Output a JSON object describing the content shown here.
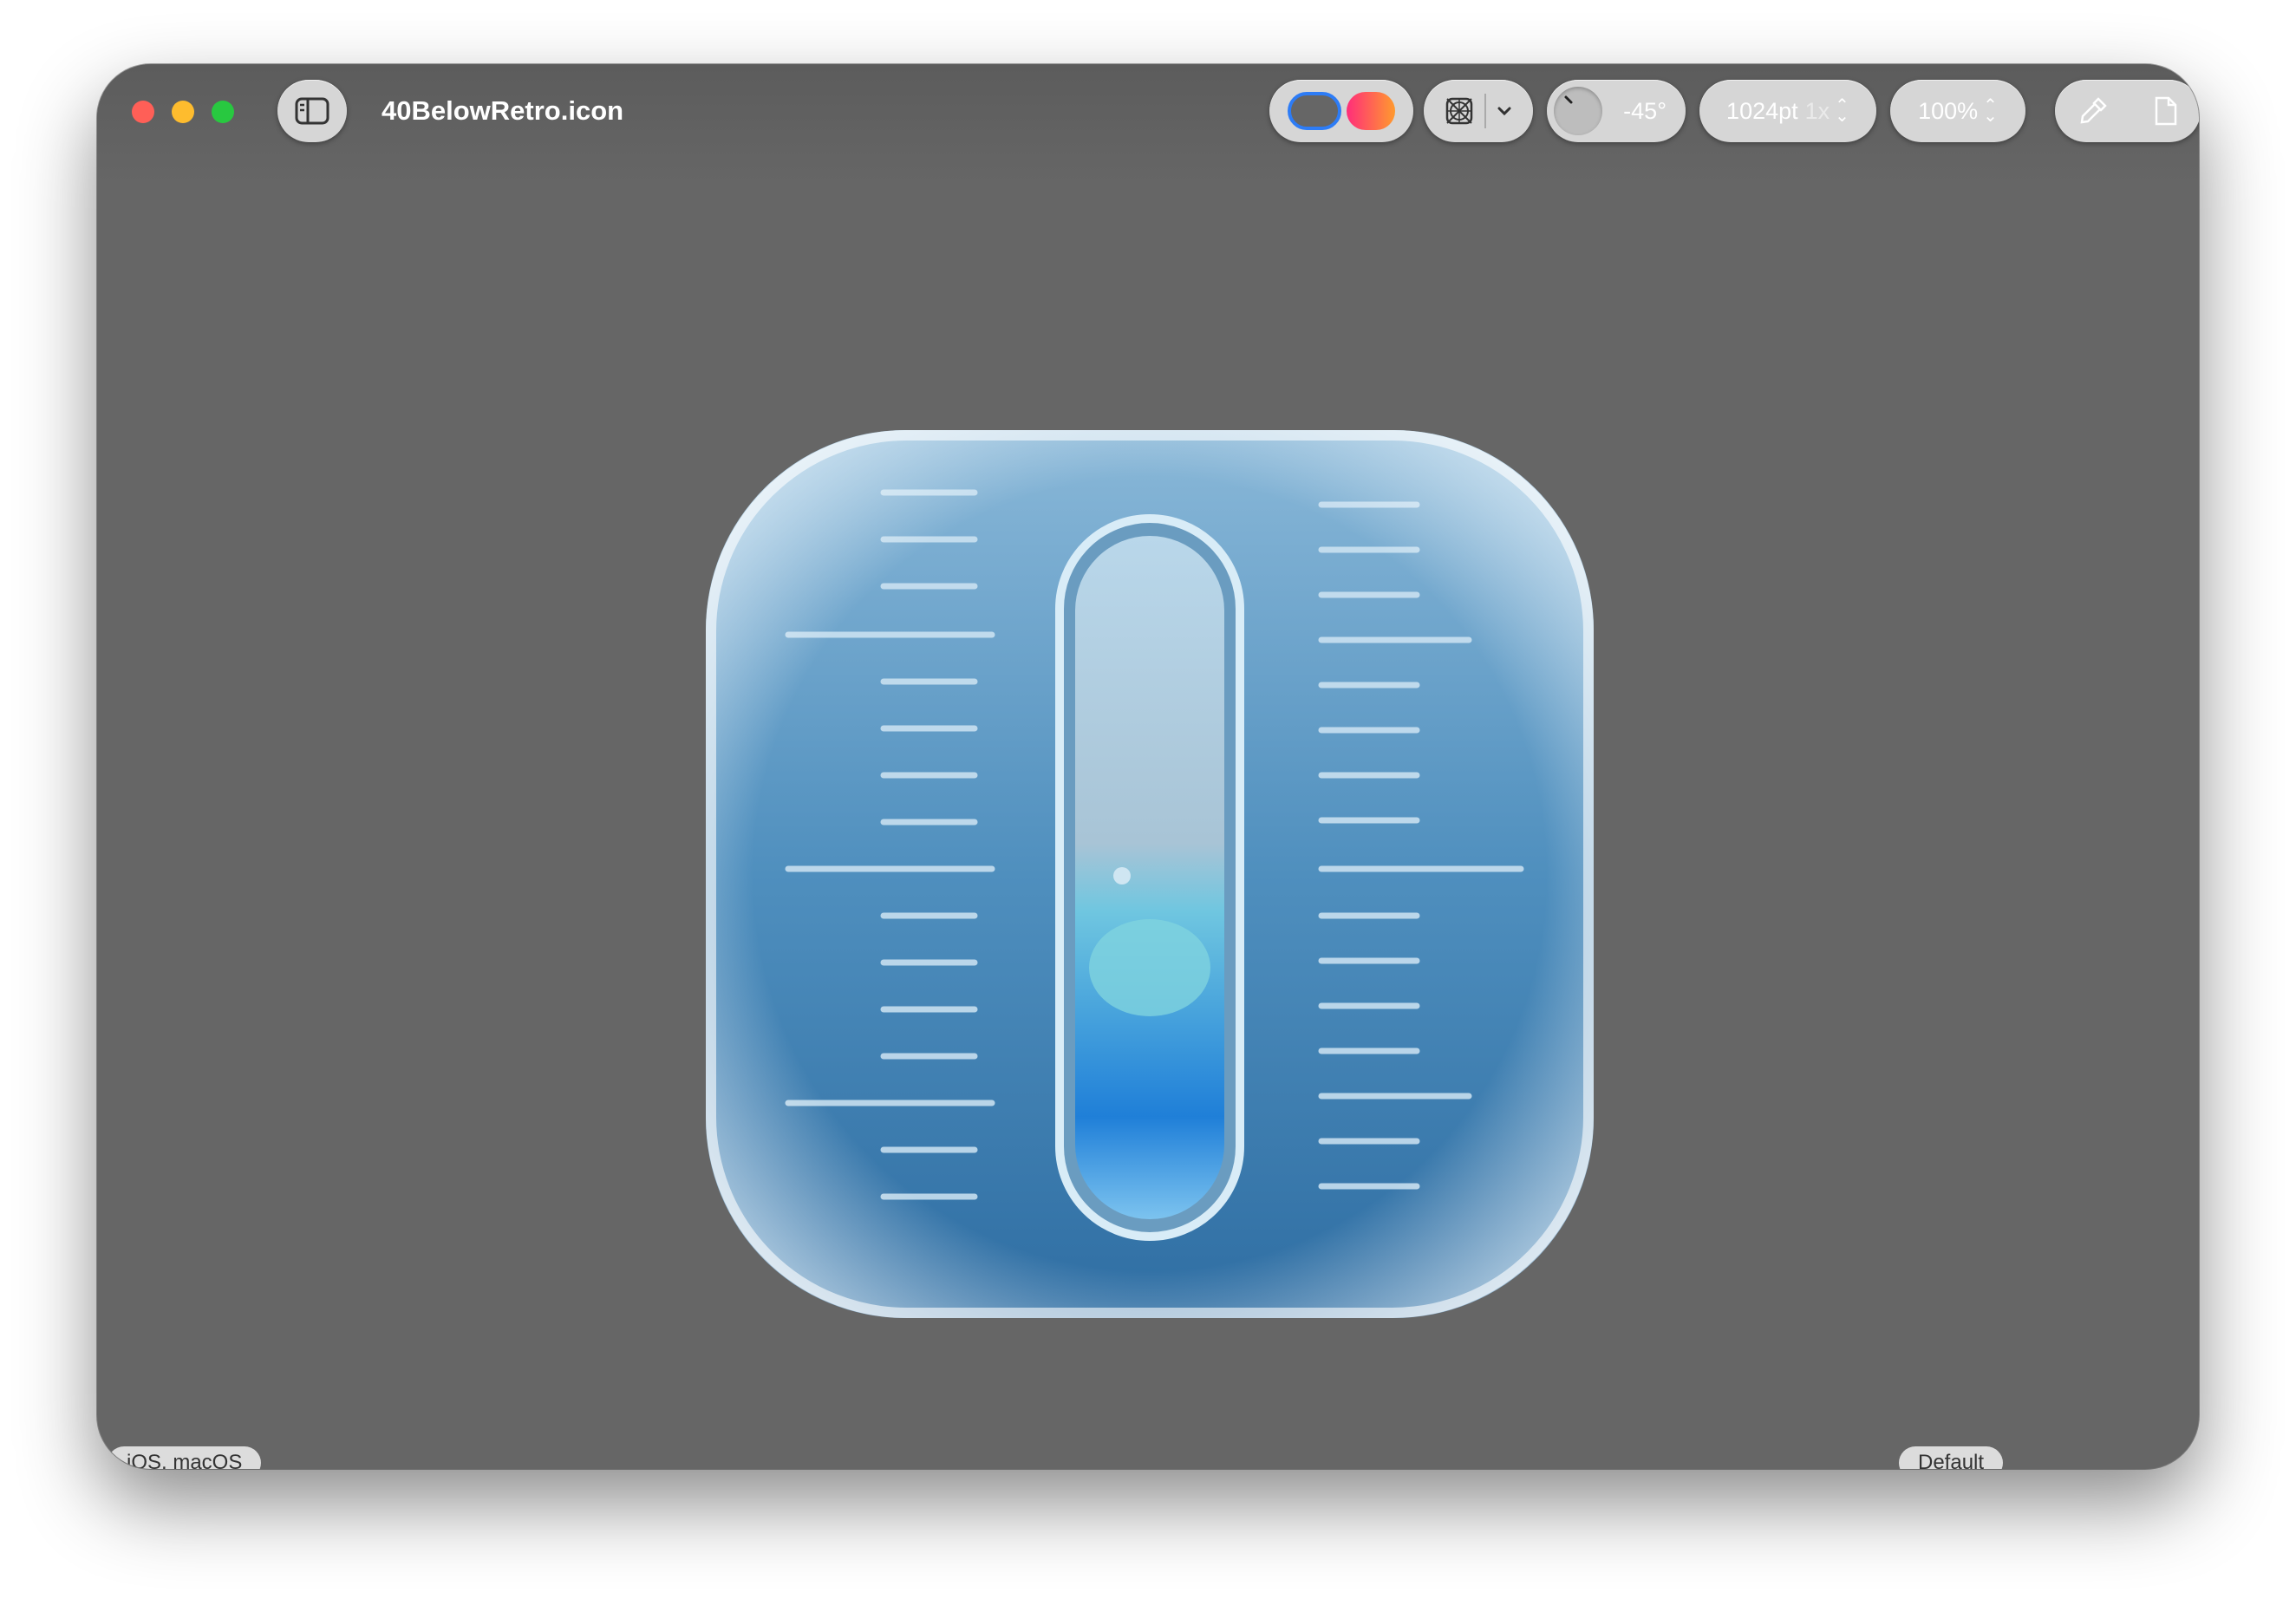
{
  "window": {
    "title": "40BelowRetro.icon",
    "traffic_lights": [
      "close",
      "minimize",
      "zoom"
    ]
  },
  "toolbar": {
    "sidebar_toggle_icon": "sidebar-icon",
    "appearance_modes": [
      "light",
      "color"
    ],
    "grid_icon": "grid-icon",
    "angle": "-45°",
    "size": "1024pt",
    "scale": "1x",
    "zoom": "100%",
    "tools": [
      "eyedropper-icon",
      "document-icon"
    ]
  },
  "canvas": {
    "platform_label": "iOS, macOS",
    "variant_label": "Default",
    "platform_thumbnails": [
      "ios-icon-preview",
      "macos-icon-preview"
    ],
    "variant_thumbnails": [
      "default-variant",
      "dark-variant",
      "tinted-variant"
    ]
  },
  "colors": {
    "window_bg": "#666666",
    "accent": "#2d7cf6",
    "icon_blue": "#4a8ab8"
  }
}
